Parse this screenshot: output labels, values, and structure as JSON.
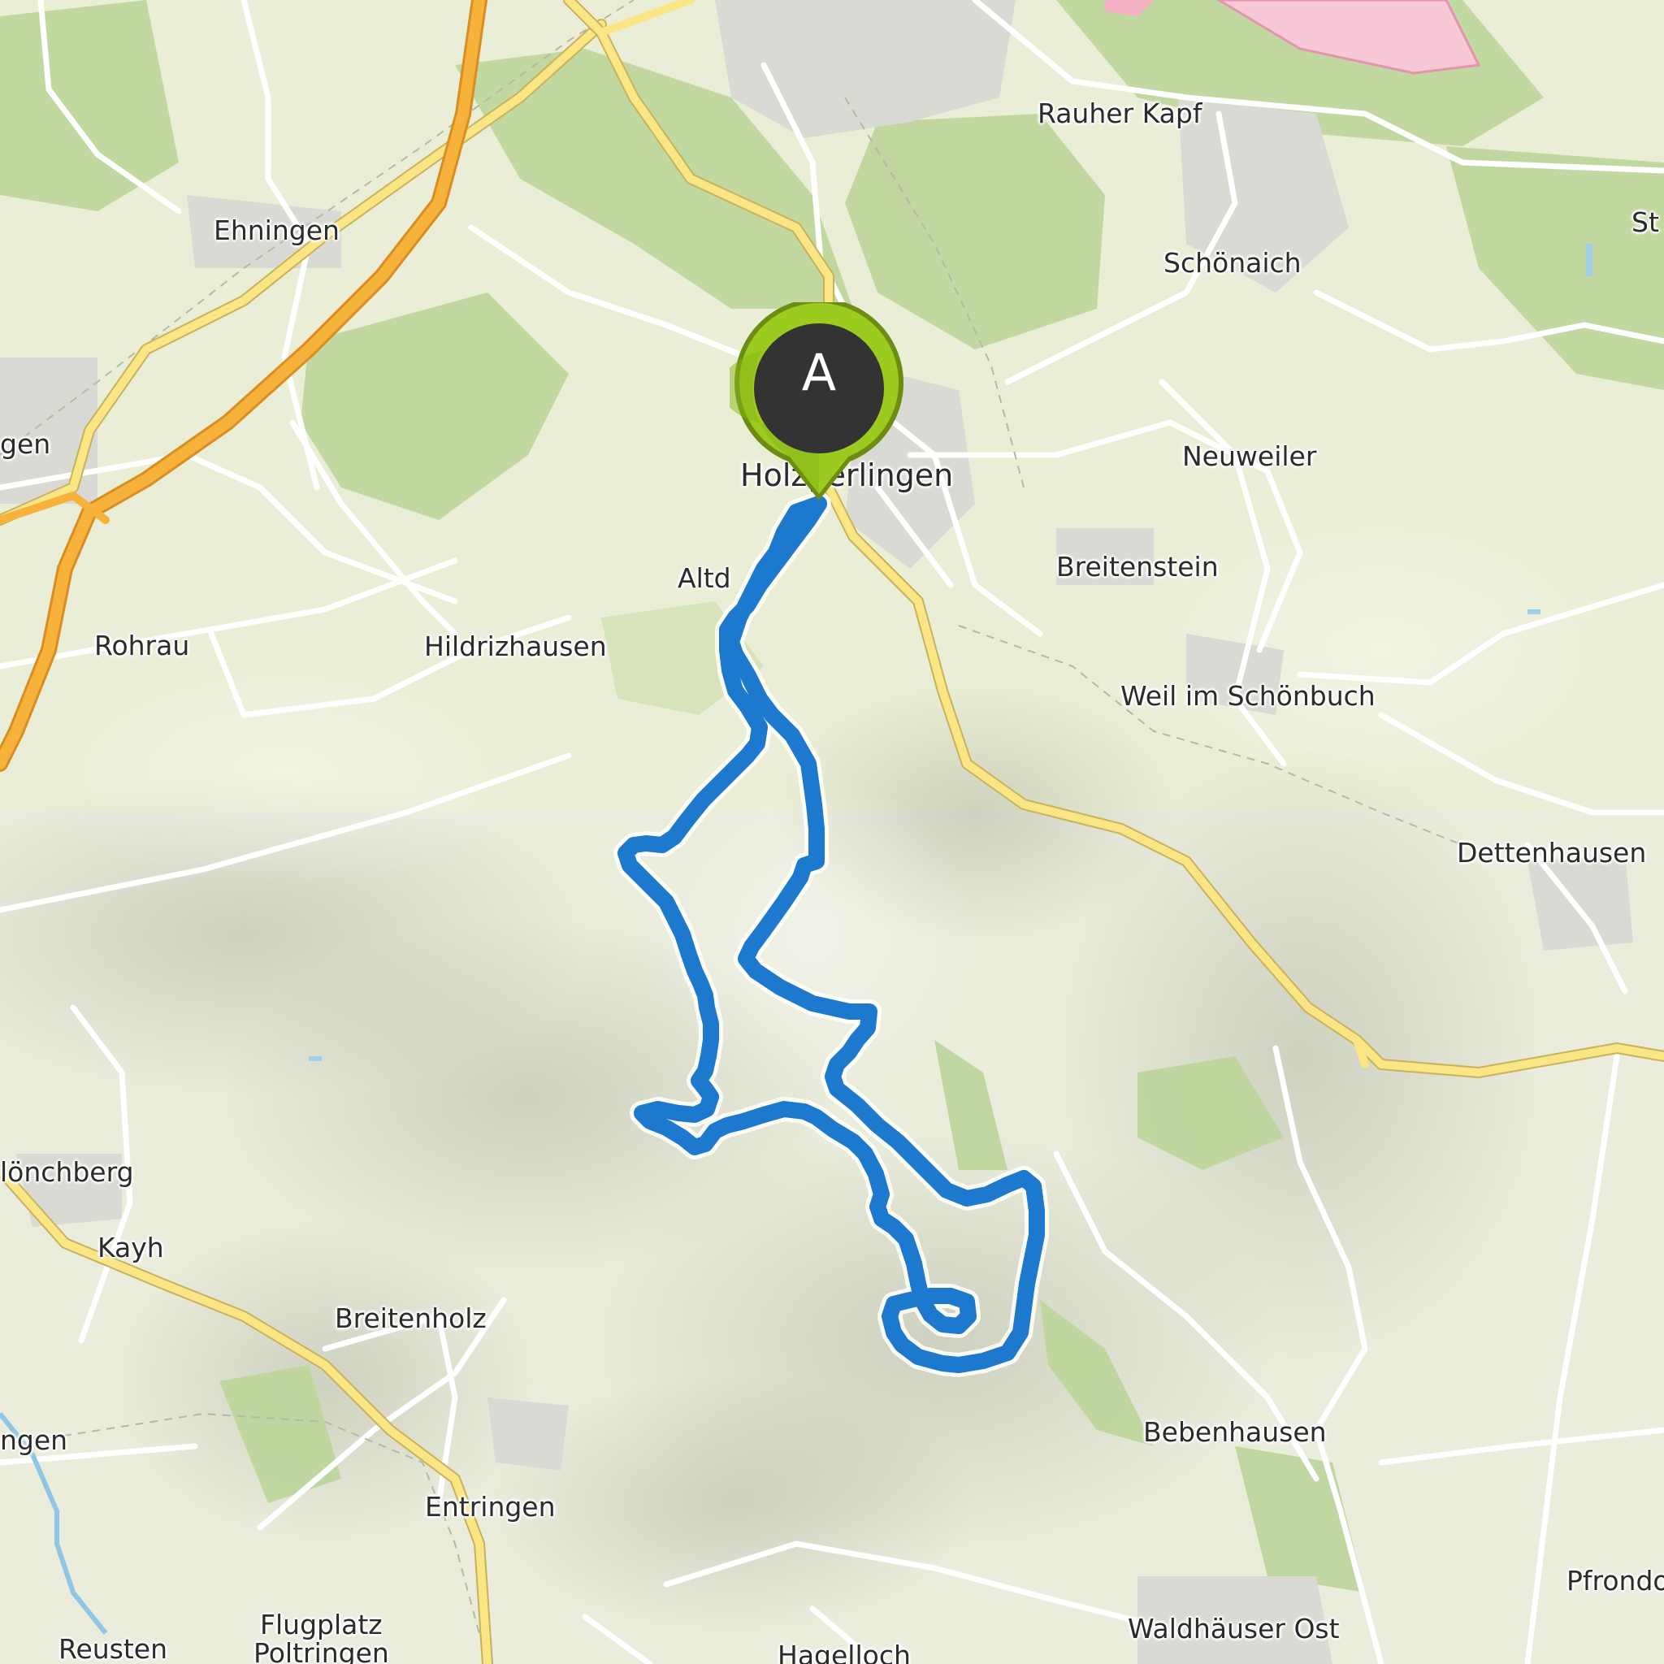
{
  "map": {
    "route_color": "#1c79cd",
    "marker": {
      "letter": "A",
      "color": "#9bcb1e",
      "inner_color": "#333333"
    },
    "places": [
      {
        "id": "rauher-kapf",
        "name": "Rauher Kapf"
      },
      {
        "id": "ehningen",
        "name": "Ehningen"
      },
      {
        "id": "schoenaich",
        "name": "Schönaich"
      },
      {
        "id": "st-cut",
        "name": "St"
      },
      {
        "id": "gen-cut",
        "name": "gen"
      },
      {
        "id": "neuweiler",
        "name": "Neuweiler"
      },
      {
        "id": "holzgerlingen",
        "name": "Holzgerlingen"
      },
      {
        "id": "altdorf",
        "name": "Altd"
      },
      {
        "id": "breitenstein",
        "name": "Breitenstein"
      },
      {
        "id": "rohrau",
        "name": "Rohrau"
      },
      {
        "id": "hildrizhausen",
        "name": "Hildrizhausen"
      },
      {
        "id": "weil-im-schoenbuch",
        "name": "Weil im Schönbuch"
      },
      {
        "id": "dettenhausen",
        "name": "Dettenhausen"
      },
      {
        "id": "moenchberg",
        "name": "lönchberg"
      },
      {
        "id": "kayh",
        "name": "Kayh"
      },
      {
        "id": "breitenholz",
        "name": "Breitenholz"
      },
      {
        "id": "bebenhausen",
        "name": "Bebenhausen"
      },
      {
        "id": "ngen-cut",
        "name": "ngen"
      },
      {
        "id": "entringen",
        "name": "Entringen"
      },
      {
        "id": "pfrondorf",
        "name": "Pfrondo"
      },
      {
        "id": "flugplatz",
        "name": "Flugplatz"
      },
      {
        "id": "poltringen",
        "name": "Poltringen"
      },
      {
        "id": "waldhaeuser-ost",
        "name": "Waldhäuser Ost"
      },
      {
        "id": "reusten",
        "name": "Reusten"
      },
      {
        "id": "hagelloch",
        "name": "Hagelloch"
      }
    ]
  }
}
